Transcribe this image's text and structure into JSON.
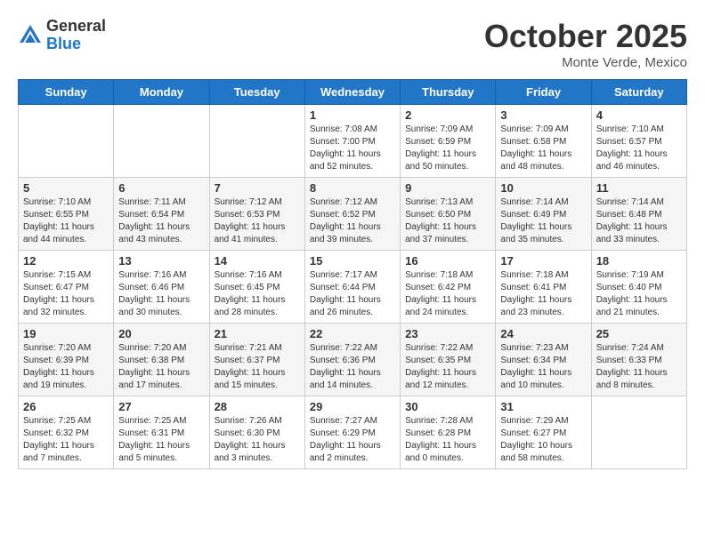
{
  "header": {
    "logo_general": "General",
    "logo_blue": "Blue",
    "month": "October 2025",
    "location": "Monte Verde, Mexico"
  },
  "days_of_week": [
    "Sunday",
    "Monday",
    "Tuesday",
    "Wednesday",
    "Thursday",
    "Friday",
    "Saturday"
  ],
  "weeks": [
    [
      {
        "day": "",
        "info": ""
      },
      {
        "day": "",
        "info": ""
      },
      {
        "day": "",
        "info": ""
      },
      {
        "day": "1",
        "info": "Sunrise: 7:08 AM\nSunset: 7:00 PM\nDaylight: 11 hours\nand 52 minutes."
      },
      {
        "day": "2",
        "info": "Sunrise: 7:09 AM\nSunset: 6:59 PM\nDaylight: 11 hours\nand 50 minutes."
      },
      {
        "day": "3",
        "info": "Sunrise: 7:09 AM\nSunset: 6:58 PM\nDaylight: 11 hours\nand 48 minutes."
      },
      {
        "day": "4",
        "info": "Sunrise: 7:10 AM\nSunset: 6:57 PM\nDaylight: 11 hours\nand 46 minutes."
      }
    ],
    [
      {
        "day": "5",
        "info": "Sunrise: 7:10 AM\nSunset: 6:55 PM\nDaylight: 11 hours\nand 44 minutes."
      },
      {
        "day": "6",
        "info": "Sunrise: 7:11 AM\nSunset: 6:54 PM\nDaylight: 11 hours\nand 43 minutes."
      },
      {
        "day": "7",
        "info": "Sunrise: 7:12 AM\nSunset: 6:53 PM\nDaylight: 11 hours\nand 41 minutes."
      },
      {
        "day": "8",
        "info": "Sunrise: 7:12 AM\nSunset: 6:52 PM\nDaylight: 11 hours\nand 39 minutes."
      },
      {
        "day": "9",
        "info": "Sunrise: 7:13 AM\nSunset: 6:50 PM\nDaylight: 11 hours\nand 37 minutes."
      },
      {
        "day": "10",
        "info": "Sunrise: 7:14 AM\nSunset: 6:49 PM\nDaylight: 11 hours\nand 35 minutes."
      },
      {
        "day": "11",
        "info": "Sunrise: 7:14 AM\nSunset: 6:48 PM\nDaylight: 11 hours\nand 33 minutes."
      }
    ],
    [
      {
        "day": "12",
        "info": "Sunrise: 7:15 AM\nSunset: 6:47 PM\nDaylight: 11 hours\nand 32 minutes."
      },
      {
        "day": "13",
        "info": "Sunrise: 7:16 AM\nSunset: 6:46 PM\nDaylight: 11 hours\nand 30 minutes."
      },
      {
        "day": "14",
        "info": "Sunrise: 7:16 AM\nSunset: 6:45 PM\nDaylight: 11 hours\nand 28 minutes."
      },
      {
        "day": "15",
        "info": "Sunrise: 7:17 AM\nSunset: 6:44 PM\nDaylight: 11 hours\nand 26 minutes."
      },
      {
        "day": "16",
        "info": "Sunrise: 7:18 AM\nSunset: 6:42 PM\nDaylight: 11 hours\nand 24 minutes."
      },
      {
        "day": "17",
        "info": "Sunrise: 7:18 AM\nSunset: 6:41 PM\nDaylight: 11 hours\nand 23 minutes."
      },
      {
        "day": "18",
        "info": "Sunrise: 7:19 AM\nSunset: 6:40 PM\nDaylight: 11 hours\nand 21 minutes."
      }
    ],
    [
      {
        "day": "19",
        "info": "Sunrise: 7:20 AM\nSunset: 6:39 PM\nDaylight: 11 hours\nand 19 minutes."
      },
      {
        "day": "20",
        "info": "Sunrise: 7:20 AM\nSunset: 6:38 PM\nDaylight: 11 hours\nand 17 minutes."
      },
      {
        "day": "21",
        "info": "Sunrise: 7:21 AM\nSunset: 6:37 PM\nDaylight: 11 hours\nand 15 minutes."
      },
      {
        "day": "22",
        "info": "Sunrise: 7:22 AM\nSunset: 6:36 PM\nDaylight: 11 hours\nand 14 minutes."
      },
      {
        "day": "23",
        "info": "Sunrise: 7:22 AM\nSunset: 6:35 PM\nDaylight: 11 hours\nand 12 minutes."
      },
      {
        "day": "24",
        "info": "Sunrise: 7:23 AM\nSunset: 6:34 PM\nDaylight: 11 hours\nand 10 minutes."
      },
      {
        "day": "25",
        "info": "Sunrise: 7:24 AM\nSunset: 6:33 PM\nDaylight: 11 hours\nand 8 minutes."
      }
    ],
    [
      {
        "day": "26",
        "info": "Sunrise: 7:25 AM\nSunset: 6:32 PM\nDaylight: 11 hours\nand 7 minutes."
      },
      {
        "day": "27",
        "info": "Sunrise: 7:25 AM\nSunset: 6:31 PM\nDaylight: 11 hours\nand 5 minutes."
      },
      {
        "day": "28",
        "info": "Sunrise: 7:26 AM\nSunset: 6:30 PM\nDaylight: 11 hours\nand 3 minutes."
      },
      {
        "day": "29",
        "info": "Sunrise: 7:27 AM\nSunset: 6:29 PM\nDaylight: 11 hours\nand 2 minutes."
      },
      {
        "day": "30",
        "info": "Sunrise: 7:28 AM\nSunset: 6:28 PM\nDaylight: 11 hours\nand 0 minutes."
      },
      {
        "day": "31",
        "info": "Sunrise: 7:29 AM\nSunset: 6:27 PM\nDaylight: 10 hours\nand 58 minutes."
      },
      {
        "day": "",
        "info": ""
      }
    ]
  ]
}
